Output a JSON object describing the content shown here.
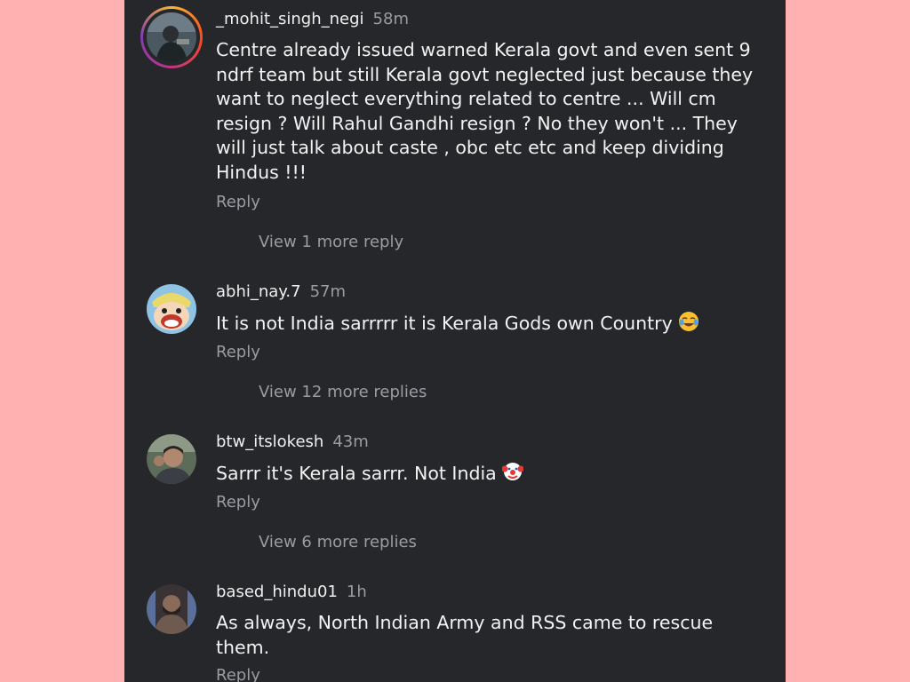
{
  "comments": [
    {
      "username": "_mohit_singh_negi",
      "time": "58m",
      "text": "Centre already issued warned Kerala govt and even sent 9\nndrf team but still Kerala govt neglected just because they\nwant to neglect everything related to centre ... Will cm\nresign ? Will Rahul Gandhi resign ? No they won't ... They\nwill just talk about caste , obc etc etc and keep dividing\nHindus !!!",
      "reply_label": "Reply",
      "more_label": "View 1 more reply",
      "has_story_ring": true
    },
    {
      "username": "abhi_nay.7",
      "time": "57m",
      "text": "It is  not India sarrrrr it is Kerala Gods own Country",
      "emoji": "face-with-tears-of-joy",
      "reply_label": "Reply",
      "more_label": "View 12 more replies"
    },
    {
      "username": "btw_itslokesh",
      "time": "43m",
      "text": "Sarrr it's Kerala sarrr. Not India",
      "emoji": "clown-face",
      "reply_label": "Reply",
      "more_label": "View 6 more replies"
    },
    {
      "username": "based_hindu01",
      "time": "1h",
      "text": "As always, North Indian Army and RSS came to rescue\nthem.",
      "reply_label": "Reply"
    }
  ],
  "colors": {
    "background": "#ffb1b1",
    "panel": "#26272b",
    "text": "#f2f2f2",
    "muted": "#9a9ca3"
  }
}
